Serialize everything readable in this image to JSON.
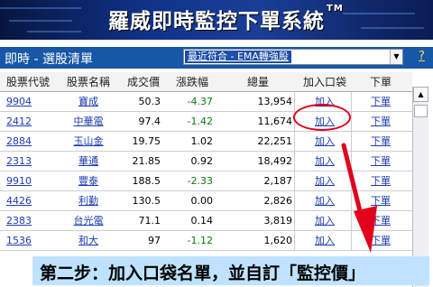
{
  "banner": {
    "title": "羅威即時監控下單系統",
    "trademark": "TM"
  },
  "toolbar": {
    "title": "即時 - 選股清單",
    "strategy_value": "最近符合 - EMA轉強股",
    "help": "?"
  },
  "columns": [
    "股票代號",
    "股票名稱",
    "成交價",
    "漲跌幅",
    "總量",
    "加入口袋",
    "下單"
  ],
  "rows": [
    {
      "code": "9904",
      "name": "寶成",
      "price": "50.3",
      "change": "-4.37",
      "volume": "13,954",
      "add": "加入",
      "order": "下單"
    },
    {
      "code": "2412",
      "name": "中華電",
      "price": "97.4",
      "change": "-1.42",
      "volume": "11,674",
      "add": "加入",
      "order": "下單"
    },
    {
      "code": "2884",
      "name": "玉山金",
      "price": "19.75",
      "change": "1.02",
      "volume": "22,251",
      "add": "加入",
      "order": "下單"
    },
    {
      "code": "2313",
      "name": "華通",
      "price": "21.85",
      "change": "0.92",
      "volume": "18,492",
      "add": "加入",
      "order": "下單"
    },
    {
      "code": "9910",
      "name": "豐泰",
      "price": "188.5",
      "change": "-2.33",
      "volume": "2,187",
      "add": "加入",
      "order": "下單"
    },
    {
      "code": "4426",
      "name": "利勤",
      "price": "130.5",
      "change": "0.00",
      "volume": "2,826",
      "add": "加入",
      "order": "下單"
    },
    {
      "code": "2383",
      "name": "台光電",
      "price": "71.1",
      "change": "0.14",
      "volume": "3,819",
      "add": "加入",
      "order": "下單"
    },
    {
      "code": "1536",
      "name": "和大",
      "price": "97",
      "change": "-1.12",
      "volume": "1,620",
      "add": "加入",
      "order": "下單"
    }
  ],
  "caption": "第二步：加入口袋名單，並自訂「監控價」",
  "colors": {
    "accent_red": "#e2001a",
    "link_blue": "#1a3cb0",
    "toolbar_blue": "#1757a8",
    "caption_bg": "#bfe3ff"
  }
}
